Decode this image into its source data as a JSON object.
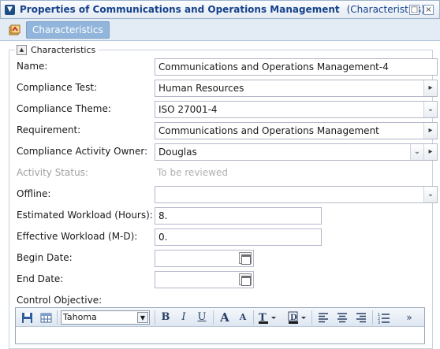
{
  "window": {
    "title": "Properties of Communications and Operations Management",
    "subtitle": "(Characteristics)",
    "collapse_icon": "chevron-down-icon",
    "restore_icon": "restore-icon",
    "close_icon": "close-icon"
  },
  "toolbar": {
    "object_icon": "object-type-icon",
    "tab_label": "Characteristics"
  },
  "section": {
    "legend": "Characteristics",
    "toggle_icon": "collapse-section-icon"
  },
  "fields": {
    "name": {
      "label": "Name:",
      "value": "Communications and Operations Management-4"
    },
    "compliance_test": {
      "label": "Compliance Test:",
      "value": "Human Resources"
    },
    "compliance_theme": {
      "label": "Compliance Theme:",
      "value": "ISO 27001-4"
    },
    "requirement": {
      "label": "Requirement:",
      "value": "Communications and Operations Management"
    },
    "owner": {
      "label": "Compliance Activity Owner:",
      "value": "Douglas"
    },
    "activity_status": {
      "label": "Activity Status:",
      "value": "To be reviewed"
    },
    "offline": {
      "label": "Offline:",
      "value": ""
    },
    "estimated_workload": {
      "label": "Estimated Workload (Hours):",
      "value": "8."
    },
    "effective_workload": {
      "label": "Effective Workload (M-D):",
      "value": "0."
    },
    "begin_date": {
      "label": "Begin Date:",
      "value": ""
    },
    "end_date": {
      "label": "End Date:",
      "value": ""
    },
    "control_objective": {
      "label": "Control Objective:"
    }
  },
  "editor": {
    "font": "Tahoma",
    "bold": "B",
    "italic": "I",
    "underline": "U",
    "grow": "A",
    "shrink": "A",
    "more": "»"
  }
}
